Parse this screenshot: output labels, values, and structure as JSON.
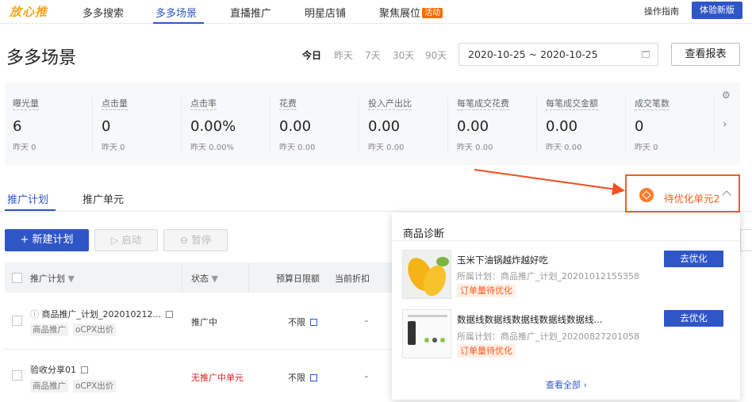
{
  "nav": {
    "logo": "放心推",
    "tabs": [
      {
        "label": "多多搜索"
      },
      {
        "label": "多多场景"
      },
      {
        "label": "直播推广"
      },
      {
        "label": "明星店铺"
      },
      {
        "label": "聚焦展位",
        "badge": "活动"
      }
    ],
    "active_tab": "多多场景",
    "guide": "操作指南",
    "new_version": "体验新版"
  },
  "page": {
    "title": "多多场景",
    "date_tabs": [
      "今日",
      "昨天",
      "7天",
      "30天",
      "90天"
    ],
    "active_date_tab": "今日",
    "date_range": "2020-10-25 ~ 2020-10-25",
    "report_button": "查看报表"
  },
  "metrics": [
    {
      "label": "曝光量",
      "value": "6",
      "yesterday": "昨天 0"
    },
    {
      "label": "点击量",
      "value": "0",
      "yesterday": "昨天 0"
    },
    {
      "label": "点击率",
      "value": "0.00%",
      "yesterday": "昨天 0.00%"
    },
    {
      "label": "花费",
      "value": "0.00",
      "yesterday": "昨天 0.00"
    },
    {
      "label": "投入产出比",
      "value": "0.00",
      "yesterday": "昨天 0.00"
    },
    {
      "label": "每笔成交花费",
      "value": "0.00",
      "yesterday": "昨天 0.00"
    },
    {
      "label": "每笔成交金额",
      "value": "0.00",
      "yesterday": "昨天 0.00"
    },
    {
      "label": "成交笔数",
      "value": "0",
      "yesterday": "昨天 0"
    }
  ],
  "subtabs": [
    "推广计划",
    "推广单元"
  ],
  "active_subtab": "推广计划",
  "optimize": {
    "label": "待优化单元2"
  },
  "toolbar": {
    "new_plan": "+ 新建计划",
    "start": "启动",
    "pause": "暂停"
  },
  "table": {
    "headers": [
      "推广计划",
      "状态",
      "预算日限额",
      "当前折扣"
    ],
    "rows": [
      {
        "name": "商品推广_计划_202010212...",
        "tags": [
          "商品推广",
          "oCPX出价"
        ],
        "status": "推广中",
        "budget": "不限",
        "discount": "-"
      },
      {
        "name": "验收分享01",
        "tags": [
          "商品推广",
          "oCPX出价"
        ],
        "status": "无推广中单元",
        "budget": "不限",
        "discount": "-"
      }
    ]
  },
  "popover": {
    "title": "商品诊断",
    "items": [
      {
        "name": "玉米下油锅越炸越好吃",
        "plan": "所属计划：商品推广_计划_20201012155358",
        "tag": "订单量待优化",
        "button": "去优化"
      },
      {
        "name": "数据线数据线数据线数据线数据线...",
        "plan": "所属计划：商品推广_计划_20200827201058",
        "tag": "订单量待优化",
        "button": "去优化"
      }
    ],
    "view_all": "查看全部"
  },
  "colors": {
    "primary": "#2e56c7",
    "annotation": "#ff5a1f",
    "warning": "#e02020"
  }
}
